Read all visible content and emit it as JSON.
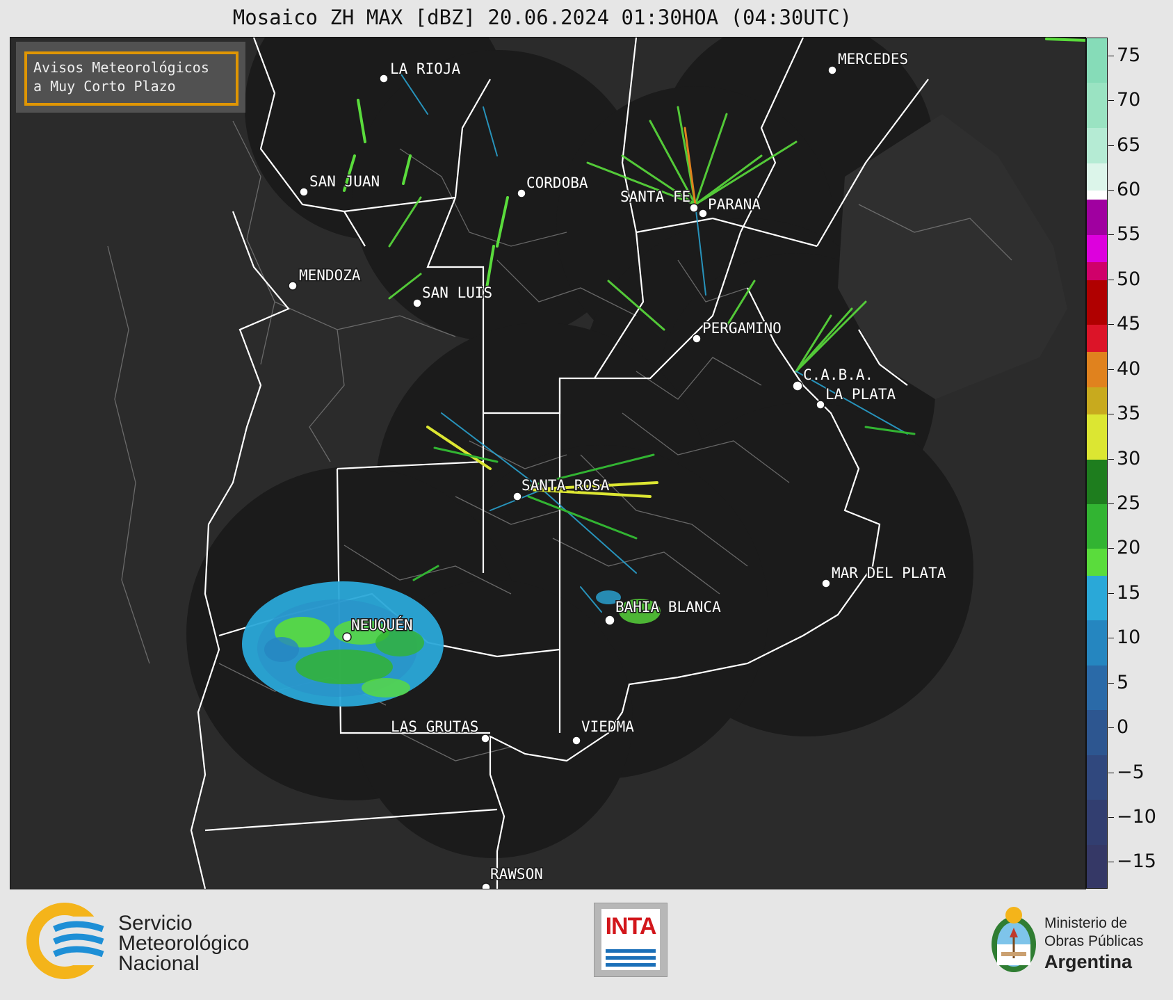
{
  "title": "Mosaico ZH MAX [dBZ] 20.06.2024 01:30HOA (04:30UTC)",
  "avisos": {
    "line1": "Avisos Meteorológicos",
    "line2": "a Muy Corto Plazo"
  },
  "cities": [
    {
      "id": "la-rioja",
      "name": "LA RIOJA"
    },
    {
      "id": "mercedes",
      "name": "MERCEDES"
    },
    {
      "id": "san-juan",
      "name": "SAN JUAN"
    },
    {
      "id": "cordoba",
      "name": "CORDOBA"
    },
    {
      "id": "santa-fe",
      "name": "SANTA FE"
    },
    {
      "id": "parana",
      "name": "PARANA"
    },
    {
      "id": "mendoza",
      "name": "MENDOZA"
    },
    {
      "id": "san-luis",
      "name": "SAN LUIS"
    },
    {
      "id": "pergamino",
      "name": "PERGAMINO"
    },
    {
      "id": "caba",
      "name": "C.A.B.A."
    },
    {
      "id": "la-plata",
      "name": "LA PLATA"
    },
    {
      "id": "santa-rosa",
      "name": "SANTA ROSA"
    },
    {
      "id": "mar-del-plata",
      "name": "MAR DEL PLATA"
    },
    {
      "id": "bahia-blanca",
      "name": "BAHIA BLANCA"
    },
    {
      "id": "neuquen",
      "name": "NEUQUÉN"
    },
    {
      "id": "las-grutas",
      "name": "LAS GRUTAS"
    },
    {
      "id": "viedma",
      "name": "VIEDMA"
    },
    {
      "id": "rawson",
      "name": "RAWSON"
    }
  ],
  "colorbar": {
    "unit": "dBZ",
    "min": -18,
    "max": 77,
    "ticks": [
      "75",
      "70",
      "65",
      "60",
      "55",
      "50",
      "45",
      "40",
      "35",
      "30",
      "25",
      "20",
      "15",
      "10",
      "5",
      "0",
      "−5",
      "−10",
      "−15"
    ],
    "segments": [
      {
        "from": 72,
        "to": 77,
        "color": "#86dcb8"
      },
      {
        "from": 67,
        "to": 72,
        "color": "#9ae3c2"
      },
      {
        "from": 63,
        "to": 67,
        "color": "#b5ebd4"
      },
      {
        "from": 60,
        "to": 63,
        "color": "#dcf5ea"
      },
      {
        "from": 59,
        "to": 60,
        "color": "#ffffff"
      },
      {
        "from": 55,
        "to": 59,
        "color": "#a000a0"
      },
      {
        "from": 52,
        "to": 55,
        "color": "#dd00dd"
      },
      {
        "from": 50,
        "to": 52,
        "color": "#d0006a"
      },
      {
        "from": 45,
        "to": 50,
        "color": "#b00000"
      },
      {
        "from": 42,
        "to": 45,
        "color": "#dc1428"
      },
      {
        "from": 38,
        "to": 42,
        "color": "#e0821e"
      },
      {
        "from": 35,
        "to": 38,
        "color": "#c8aa1e"
      },
      {
        "from": 30,
        "to": 35,
        "color": "#dce632"
      },
      {
        "from": 25,
        "to": 30,
        "color": "#1e7d1e"
      },
      {
        "from": 20,
        "to": 25,
        "color": "#32b432"
      },
      {
        "from": 17,
        "to": 20,
        "color": "#5adc3c"
      },
      {
        "from": 12,
        "to": 17,
        "color": "#2aa8d8"
      },
      {
        "from": 7,
        "to": 12,
        "color": "#2586c0"
      },
      {
        "from": 2,
        "to": 7,
        "color": "#2a6aa8"
      },
      {
        "from": -3,
        "to": 2,
        "color": "#2d5690"
      },
      {
        "from": -8,
        "to": -3,
        "color": "#30487e"
      },
      {
        "from": -13,
        "to": -8,
        "color": "#323e70"
      },
      {
        "from": -18,
        "to": -13,
        "color": "#353866"
      }
    ]
  },
  "footer": {
    "smn_line1": "Servicio",
    "smn_line2": "Meteorológico",
    "smn_line3": "Nacional",
    "inta": "INTA",
    "mop_line1": "Ministerio de",
    "mop_line2": "Obras Públicas",
    "mop_line3": "Argentina"
  }
}
